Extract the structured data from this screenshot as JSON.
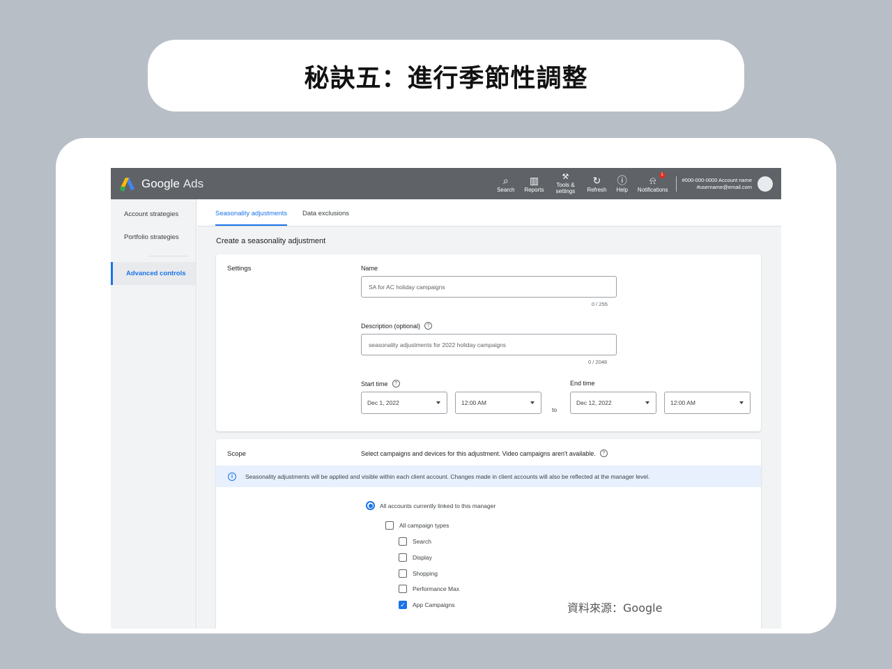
{
  "slide": {
    "title": "秘訣五：進行季節性調整",
    "source": "資料來源：Google"
  },
  "topbar": {
    "brand": "Google",
    "brand_suffix": "Ads",
    "items": [
      {
        "icon": "search-icon",
        "label": "Search"
      },
      {
        "icon": "reports-icon",
        "label": "Reports"
      },
      {
        "icon": "wrench-icon",
        "label": "Tools & settings"
      },
      {
        "icon": "refresh-icon",
        "label": "Refresh"
      },
      {
        "icon": "help-icon",
        "label": "Help"
      },
      {
        "icon": "bell-icon",
        "label": "Notifications",
        "badge": "1"
      }
    ],
    "account_line1": "#000-000-0000 Account name",
    "account_line2": "#username@email.com"
  },
  "sidebar": {
    "items": [
      {
        "label": "Account strategies"
      },
      {
        "label": "Portfolio strategies"
      },
      {
        "label": "Advanced controls"
      }
    ]
  },
  "tabs": [
    {
      "label": "Seasonality adjustments"
    },
    {
      "label": "Data exclusions"
    }
  ],
  "form": {
    "heading": "Create a seasonality adjustment",
    "settings_label": "Settings",
    "name_label": "Name",
    "name_value": "SA for AC holiday campaigns",
    "name_counter": "0 / 255",
    "desc_label": "Description (optional)",
    "desc_value": "seasonality adjustments for 2022 holiday campaigns",
    "desc_counter": "0 / 2048",
    "start_label": "Start time",
    "start_date": "Dec 1, 2022",
    "start_time": "12:00 AM",
    "to_label": "to",
    "end_label": "End time",
    "end_date": "Dec 12, 2022",
    "end_time": "12:00 AM"
  },
  "scope": {
    "label": "Scope",
    "description": "Select campaigns and devices for this adjustment. Video campaigns aren't available.",
    "info": "Seasonality adjustments will be applied and visible within each client account. Changes made in client accounts will also be reflected at the manager level.",
    "radio_label": "All accounts currently linked to this manager",
    "all_types_label": "All campaign types",
    "campaign_types": [
      {
        "label": "Search",
        "checked": false
      },
      {
        "label": "Display",
        "checked": false
      },
      {
        "label": "Shopping",
        "checked": false
      },
      {
        "label": "Performance Max",
        "checked": false
      },
      {
        "label": "App Campaigns",
        "checked": true
      }
    ]
  }
}
